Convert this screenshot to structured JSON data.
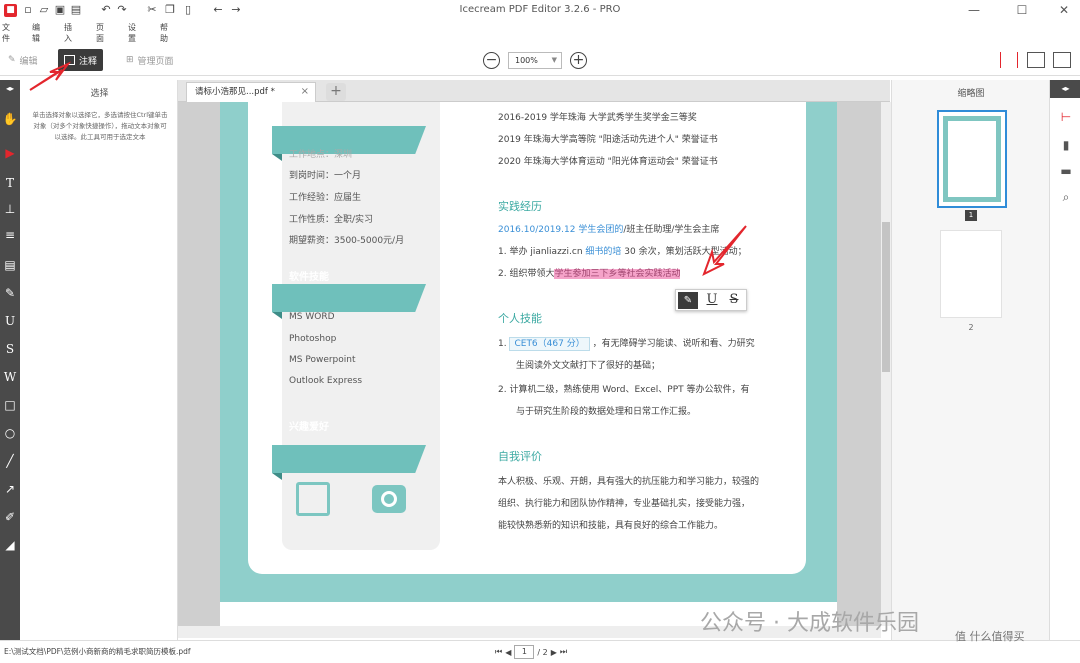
{
  "title_bar": {
    "window_title": "Icecream PDF Editor 3.2.6 - PRO",
    "minimize": "—",
    "maximize": "☐",
    "close": "✕"
  },
  "menu": [
    "文件",
    "编辑",
    "插入",
    "页面",
    "设置",
    "帮助"
  ],
  "modes": {
    "edit": "编辑",
    "annotate": "注释",
    "manage_pages": "管理页面"
  },
  "zoom": {
    "value": "100%"
  },
  "left_panel": {
    "title": "选择",
    "help_text": "单击选择对象以选择它，多选请按住Ctrl键单击对象（对多个对象快捷操作），拖动文本对象可以选择。此工具可用于选定文本"
  },
  "tabs": [
    {
      "label": "请标小浩那见...pdf *"
    }
  ],
  "new_tab": "+",
  "resume": {
    "sidebar": {
      "top_lines": [
        "工作地点：深圳",
        "到岗时间：一个月",
        "工作经验：应届生",
        "工作性质：全职/实习",
        "期望薪资：3500-5000元/月"
      ],
      "section_skills": "软件技能",
      "skills": [
        "MS WORD",
        "Photoshop",
        "MS Powerpoint",
        "Outlook Express"
      ],
      "section_hobbies": "兴趣爱好"
    },
    "main": {
      "award_lines": [
        "2016-2019 学年珠海  大学武秀学生奖学金三等奖",
        "2019 年珠海大学高等院 \"阳途活动先进个人\" 荣誉证书",
        "2020 年珠海大学体育运动 \"阳光体育运动会\" 荣誉证书"
      ],
      "section_practice": "实践经历",
      "practice_date": "2016.10/2019.12",
      "practice_org": "学生会团的",
      "practice_role": "/班主任助理/学生会主席",
      "practice_item1_prefix": "1. 举办",
      "practice_item1_site": "jianliazzi.cn",
      "practice_item1_link": "细书的培",
      "practice_item1_suffix": "30 余次，策划活跃大型活动；",
      "practice_item2_prefix": "2. 组织带领大",
      "practice_item2_highlight": "学生参加三下乡等社会实践活动",
      "section_personal": "个人技能",
      "skill1_num": "1.",
      "skill1_badge": "CET6（467 分）",
      "skill1_text": "，有无障碍学习能读、说听和看、力研究",
      "skill1_text2": "生阅读外文文献打下了很好的基础；",
      "skill2_num": "2.",
      "skill2_text": "计算机二级，熟练使用 Word、Excel、PPT 等办公软件，有",
      "skill2_text2": "与于研究生阶段的数据处理和日常工作汇报。",
      "section_self": "自我评价",
      "self_lines": [
        "本人积极、乐观、开朗，具有强大的抗压能力和学习能力，较强的",
        "组织、执行能力和团队协作精神，专业基础扎实，接受能力强，",
        "能较快熟悉新的知识和技能，具有良好的综合工作能力。"
      ]
    }
  },
  "float_toolbar": {
    "pen": "✎",
    "underline": "U",
    "strike": "S"
  },
  "thumbnails": {
    "title": "缩略图",
    "pages": [
      {
        "num": "1"
      },
      {
        "num": "2"
      }
    ]
  },
  "status": {
    "file_path": "E:\\测试文档\\PDF\\范例小商新商的精毛求职简历模板.pdf",
    "current_page": "1",
    "total_pages": "/ 2"
  },
  "watermark": "公众号 · 大成软件乐园",
  "corner_watermark": "值 什么值得买",
  "colors": {
    "accent": "#e3262d",
    "teal": "#8fcfcb",
    "selection": "#2f8cd8"
  }
}
